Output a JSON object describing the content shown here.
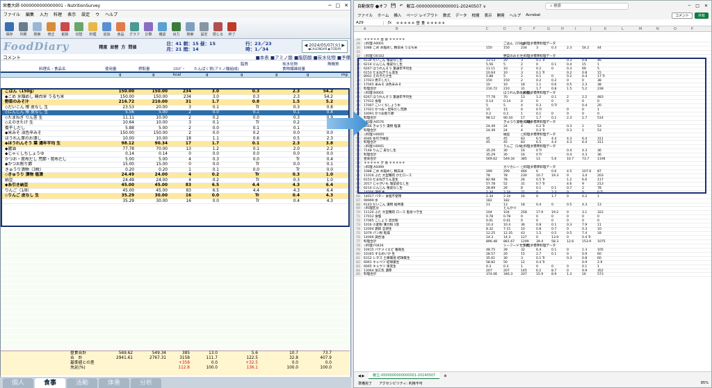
{
  "left": {
    "title": "栄養大師 0000000000000001 - NutritionSurvey",
    "menu": [
      "ファイル",
      "編集",
      "入力",
      "料理",
      "表示",
      "設定",
      "ウ",
      "ヘルプ"
    ],
    "tools": [
      "保存",
      "印刷",
      "検索",
      "修正",
      "削除",
      "切替",
      "料理",
      "追加",
      "食品",
      "グラフ",
      "計算",
      "確認",
      "出力",
      "検索",
      "設定",
      "閉じる",
      "終了"
    ],
    "logo": "FoodDiary",
    "buttons": [
      "精度",
      "並替",
      "方",
      "問値"
    ],
    "nut_a": [
      "日：41 朝：15 昼：15",
      "月：21 間：14"
    ],
    "nut_b": [
      "行：23／23",
      "時：1／34"
    ],
    "date": "◀ 2024/05/07(火) ▶",
    "date_sub": "◀CALENDAR ▶TODAY",
    "comment_label": "コメント",
    "flags": "■本表 ■アミノ酸 ■脂肪酸 ■炭水化物 ■予備",
    "cols": [
      "料理名・食品名",
      "使用量",
      "摂取量",
      "ｴﾈﾙｷﾞｰ",
      "たんぱく質(アミノ酸組成)",
      "脂質",
      "炭水化物",
      "食物繊維総量",
      "無機質"
    ],
    "units": [
      "g",
      "g",
      "kcal",
      "g",
      "g",
      "g",
      "g",
      "mg"
    ],
    "rows": [
      {
        "n": "ごはん（150g）",
        "a": "150.00",
        "b": "150.00",
        "e": "234",
        "p": "3.0",
        "f": "0.3",
        "c": "2.3",
        "x": "54.2",
        "t": "cat"
      },
      {
        "n": "◆こめ 水稲めし 精白米 うるち米",
        "a": "150.00",
        "b": "150.00",
        "e": "234",
        "p": "3.0",
        "f": "0.3",
        "c": "2.3",
        "x": "54.2",
        "t": ""
      },
      {
        "n": "野菜のみそ汁",
        "a": "216.72",
        "b": "210.00",
        "e": "31",
        "p": "1.7",
        "f": "0.8",
        "c": "1.5",
        "x": "5.2",
        "t": "cat"
      },
      {
        "n": "◇だいこん 根 皮なし 生",
        "a": "23.53",
        "b": "20.00",
        "e": "3",
        "p": "0.1",
        "f": "Tr",
        "c": "0.3",
        "x": "0.8",
        "t": ""
      },
      {
        "n": "◇にんじん 根 皮なし 生",
        "a": "5.56",
        "b": "5.00",
        "e": "2",
        "p": "0.0",
        "f": "0.1",
        "c": "0.1",
        "x": "0.4",
        "t": "sel"
      },
      {
        "n": "◇たまねぎ りん茎 生",
        "a": "11.11",
        "b": "10.00",
        "e": "2",
        "p": "0.2",
        "f": "0.0",
        "c": "0.3",
        "x": "0.9",
        "t": ""
      },
      {
        "n": "◇えのきたけ 生",
        "a": "10.64",
        "b": "10.00",
        "e": "3",
        "p": "0.1",
        "f": "Tr",
        "c": "0.2",
        "x": "0.8",
        "t": ""
      },
      {
        "n": "煮干しだし",
        "a": "5.88",
        "b": "5.00",
        "e": "2",
        "p": "0.0",
        "f": "0.1",
        "c": "0.1",
        "x": "0.4",
        "t": ""
      },
      {
        "n": "◆米みそ 淡色辛みそ",
        "a": "150.00",
        "b": "150.00",
        "e": "2",
        "p": "0.0",
        "f": "0.2",
        "c": "0.0",
        "x": "0.0",
        "t": ""
      },
      {
        "n": "ほうれん草のお浸し",
        "a": "10.00",
        "b": "10.00",
        "e": "18",
        "p": "1.1",
        "f": "0.6",
        "c": "0.5",
        "x": "2.3",
        "t": ""
      },
      {
        "n": "◆ほうれんそう 葉 通年平均 生",
        "a": "98.12",
        "b": "90.34",
        "e": "17",
        "p": "1.7",
        "f": "0.1",
        "c": "2.3",
        "x": "3.8",
        "t": "cat"
      },
      {
        "n": "◆醤油",
        "a": "77.78",
        "b": "70.00",
        "e": "13",
        "p": "1.2",
        "f": "0.1",
        "c": "2.0",
        "x": "2.2",
        "t": ""
      },
      {
        "n": "◆じゃくしちしょうゆ",
        "a": "0.14",
        "b": "0.14",
        "e": "0",
        "p": "0.0",
        "f": "0.0",
        "c": "0.0",
        "x": "0.0",
        "t": ""
      },
      {
        "n": "かつお・昆布だし 荒節・昆布だし",
        "a": "5.00",
        "b": "5.00",
        "e": "4",
        "p": "0.3",
        "f": "0.0",
        "c": "Tr",
        "x": "0.4",
        "t": ""
      },
      {
        "n": "◆かつお削り節",
        "a": "15.00",
        "b": "15.00",
        "e": "0",
        "p": "0.0",
        "f": "Tr",
        "c": "0.0",
        "x": "0.1",
        "t": ""
      },
      {
        "n": "きゅうり漬物（3枚）",
        "a": "0.20",
        "b": "0.20",
        "e": "1",
        "p": "0.1",
        "f": "0.0",
        "c": "Tr",
        "x": "0.0",
        "t": ""
      },
      {
        "n": "◇きゅうり 漬物 塩漬",
        "a": "24.49",
        "b": "24.00",
        "e": "4",
        "p": "0.2",
        "f": "Tr",
        "c": "0.3",
        "x": "1.0",
        "t": "cat"
      },
      {
        "n": "納豆",
        "a": "24.49",
        "b": "24.00",
        "e": "4",
        "p": "0.2",
        "f": "Tr",
        "c": "0.3",
        "x": "1.0",
        "t": ""
      },
      {
        "n": "◆糸引き納豆",
        "a": "45.00",
        "b": "45.00",
        "e": "83",
        "p": "6.5",
        "f": "4.4",
        "c": "4.3",
        "x": "6.4",
        "t": "cat"
      },
      {
        "n": "りんご（1/8）",
        "a": "45.00",
        "b": "45.00",
        "e": "83",
        "p": "6.5",
        "f": "4.4",
        "c": "4.3",
        "x": "6.4",
        "t": ""
      },
      {
        "n": "◇りんご 皮なし 生",
        "a": "35.29",
        "b": "30.00",
        "e": "16",
        "p": "0.0",
        "f": "Tr",
        "c": "0.4",
        "x": "4.3",
        "t": "cat"
      },
      {
        "n": "",
        "a": "35.29",
        "b": "30.00",
        "e": "16",
        "p": "0.0",
        "f": "Tr",
        "c": "0.4",
        "x": "4.3",
        "t": ""
      }
    ],
    "sum": [
      {
        "l": "昼食合計",
        "a": "569.62",
        "b": "549.34",
        "e": "385",
        "p": "13.0",
        "f": "5.6",
        "c": "10.7",
        "x": "73.7"
      },
      {
        "l": "合　計",
        "a": "2941.61",
        "b": "2767.31",
        "e": "3158",
        "p": "111.7",
        "f": "122.5",
        "c": "32.8",
        "x": "407.9"
      },
      {
        "l": "基準値との差",
        "a": "",
        "b": "",
        "e": "+358",
        "p": "0.0",
        "f": "+32.5",
        "c": "0.0",
        "x": "0.0"
      },
      {
        "l": "充足(%)",
        "a": "",
        "b": "",
        "e": "112.8",
        "p": "100.0",
        "f": "136.1",
        "c": "100.0",
        "x": "100.0"
      }
    ],
    "tabs": [
      "個人",
      "食事",
      "活動",
      "体重",
      "分析"
    ]
  },
  "right": {
    "title": "献立-0000000000000001-20240507 ∨",
    "autosave": "自動保存 ●オフ",
    "search": "検索",
    "menu": [
      "ファイル",
      "ホーム",
      "挿入",
      "ページ レイアウト",
      "数式",
      "データ",
      "校閲",
      "表示",
      "開発",
      "ヘルプ",
      "Acrobat"
    ],
    "btn_comment": "コメント",
    "btn_share": "共有",
    "cellref": "A29",
    "formula": "＊＊＊＊＊ 昼 食 ＊＊＊＊＊",
    "cols": [
      "A",
      "B",
      "C",
      "D",
      "E",
      "F",
      "G",
      "H",
      "I",
      "J",
      "K",
      "L",
      "M",
      "N",
      "O",
      "P"
    ],
    "rows": [
      [
        "28",
        "＊＊＊＊＊ 昼 食 ＊＊＊＊＊",
        "",
        "",
        "",
        "",
        "",
        "",
        "",
        ""
      ],
      [
        "29",
        "◇料理 A0001",
        "",
        "ごはん（150g）",
        "□料理ダ標準料理データ",
        "",
        "",
        "",
        "",
        ""
      ],
      [
        "30",
        "1088 こめ 水稲めし 精白米 うるち米",
        "150",
        "150",
        "234",
        "3",
        "0.3",
        "2.3",
        "54.2",
        "44"
      ],
      [
        "31",
        "",
        "",
        "",
        "",
        "",
        "",
        "",
        "",
        ""
      ],
      [
        "32",
        "◇料理 O0102",
        "",
        "野菜のみそ汁",
        "□料理ダ標準料理データ",
        "",
        "",
        "",
        "",
        ""
      ],
      [
        "33",
        "6134 だいこん 根皮なし生",
        "23.53",
        "20",
        "3",
        "0.1 Tr",
        "",
        "0.3",
        "0.8",
        "46"
      ],
      [
        "34",
        "6214 にんじん 根皮なし生",
        "5.56",
        "5",
        "2",
        "0",
        "0.1",
        "0.4",
        "15",
        "1"
      ],
      [
        "35",
        "6267 ほうれんそう 葉通年平均生",
        "11.11",
        "10",
        "2",
        "0.2",
        "0",
        "0.3",
        "69",
        "5"
      ],
      [
        "36",
        "6153 たまねぎりん茎生",
        "10.64",
        "10",
        "3",
        "0.1 Tr",
        "",
        "0.2",
        "0.8",
        "15"
      ],
      [
        "37",
        "8001 えのきたけ生",
        "5.88",
        "5",
        "2",
        "0.1",
        "0",
        "0.2",
        "0.4",
        "17 Tr"
      ],
      [
        "38",
        "17023 煮干しだし",
        "150",
        "150",
        "2",
        "0.2",
        "0.2",
        "0",
        "0",
        "38"
      ],
      [
        "39",
        "17045 米みそ 淡色辛みそ",
        "10",
        "10",
        "18",
        "1.1",
        "0.6",
        "0.5",
        "2.3",
        "38"
      ],
      [
        "40",
        "料理合計",
        "216.72",
        "210",
        "31",
        "1.7",
        "0.8",
        "1.5",
        "5.2",
        "238"
      ],
      [
        "41",
        "◇料理 B0001",
        "",
        "ほうれん草のお浸し",
        "□料理ダ標準料理データ",
        "",
        "",
        "",
        "",
        ""
      ],
      [
        "42",
        "6267 ほうれんそう 葉通年平均生",
        "77.78",
        "70",
        "13",
        "1.2",
        "0.1",
        "2",
        "2.2",
        "483"
      ],
      [
        "43",
        "17012 食塩",
        "0.14",
        "0.14",
        "0",
        "0",
        "0",
        "0",
        "0",
        "0"
      ],
      [
        "44",
        "17007 こいくちしょうゆ",
        "5",
        "5",
        "4",
        "0.3",
        "0 Tr",
        "",
        "0.4",
        "20"
      ],
      [
        "45",
        "17021 かつお・昆布だし荒節",
        "15",
        "15",
        "0",
        "0 Tr",
        "",
        "0",
        "0",
        "1"
      ],
      [
        "46",
        "10091 かつお削り節",
        "0.2",
        "0.2",
        "1",
        "0.1",
        "0",
        "0",
        "0",
        "0"
      ],
      [
        "47",
        "料理合計",
        "98.12",
        "90.34",
        "17",
        "1.7",
        "0.1",
        "2.3",
        "2.7",
        "514"
      ],
      [
        "48",
        "◇料理 A0576",
        "",
        "きゅうり漬物（3枚）",
        "□料理ダ標準料理データ",
        "",
        "",
        "",
        "",
        ""
      ],
      [
        "49",
        "6066 きゅうり 漬物 塩漬",
        "24.49",
        "24",
        "4",
        "0.2 Tr",
        "",
        "0.3",
        "1",
        "53"
      ],
      [
        "50",
        "料理合計",
        "24.49",
        "24",
        "4",
        "0.2 Tr",
        "",
        "0.3",
        "1",
        "53"
      ],
      [
        "51",
        "◇料理 H0005",
        "",
        "納豆",
        "□料理ダ標準料理データ",
        "",
        "",
        "",
        "",
        ""
      ],
      [
        "52",
        "4046 糸引き納豆",
        "45",
        "45",
        "83",
        "6.5",
        "4.4",
        "4.3",
        "6.4",
        "311"
      ],
      [
        "53",
        "料理合計",
        "45",
        "45",
        "83",
        "6.5",
        "4.4",
        "4.3",
        "6.4",
        "311"
      ],
      [
        "54",
        "◇料理 H0001",
        "",
        "りんご（1/8）",
        "□料理ダ標準料理データ",
        "",
        "",
        "",
        "",
        ""
      ],
      [
        "55",
        "7148 りんご 皮なし生",
        "35.29",
        "30",
        "16",
        "0 Tr",
        "",
        "0.4",
        "4.3",
        "36"
      ],
      [
        "56",
        "料理合計",
        "35.29",
        "30",
        "16",
        "0 Tr",
        "",
        "0.4",
        "4.3",
        "36"
      ],
      [
        "57",
        "昼食合計",
        "569.62",
        "549.34",
        "385",
        "13",
        "5.6",
        "10.7",
        "73.7",
        "1194"
      ],
      [
        "58",
        "＊＊＊＊＊ 夕 食 ＊＊＊＊＊",
        "",
        "",
        "",
        "",
        "",
        "",
        "",
        ""
      ],
      [
        "59",
        "◇料理 A0499",
        "",
        "カツカレー",
        "□料理ダ標準料理データ",
        "",
        "",
        "",
        "",
        ""
      ],
      [
        "60",
        "1088 こめ 水稲めし 精白米",
        "299",
        "299",
        "466",
        "6",
        "0.6",
        "4.5",
        "107.9",
        "87"
      ],
      [
        "61",
        "11016 ぶた 大型種肉 かたロース",
        "78",
        "78",
        "230",
        "10.7",
        "19.3",
        "0",
        "3.4",
        "203"
      ],
      [
        "62",
        "6153 たまねぎりん茎生",
        "82.98",
        "78",
        "26",
        "0.5 Tr",
        "",
        "1.2",
        "6.6",
        "117"
      ],
      [
        "63",
        "2017 じゃがいも 塊茎皮なし生",
        "57.78",
        "52",
        "31",
        "0.7 Tr",
        "",
        "4.6",
        "9",
        "213"
      ],
      [
        "64",
        "6214 にんじん 根皮なし生",
        "28.89",
        "26",
        "8",
        "0.1",
        "0.1",
        "0.7",
        "2",
        "78"
      ],
      [
        "65",
        "14006 調合油",
        "2.34",
        "2.34",
        "21",
        "0",
        "2.3",
        "0",
        "0",
        "0 Tr"
      ],
      [
        "66",
        "14017 バター 食塩不使用",
        "2.34",
        "2.34",
        "16",
        "0",
        "1.7",
        "0",
        "0.2",
        "1"
      ],
      [
        "67",
        "99999 水",
        "182",
        "182",
        "",
        "",
        "",
        "",
        "",
        ""
      ],
      [
        "68",
        "6143 だいこん 漬物 福神漬",
        "13",
        "13",
        "18",
        "0.4",
        "0",
        "0.5",
        "4.3",
        "13"
      ],
      [
        "69",
        "◇料理区分",
        "",
        "とんかつ",
        "",
        "",
        "",
        "",
        "",
        ""
      ],
      [
        "70",
        "11120 ぶた 大型種肉 ロース 脂身つき生",
        "104",
        "104",
        "258",
        "17.9",
        "19.2",
        "0",
        "3.1",
        "322"
      ],
      [
        "71",
        "17012 食塩",
        "0.78",
        "0.78",
        "0",
        "0",
        "0",
        "0",
        "0",
        "0"
      ],
      [
        "72",
        "17065 こしょう 混合粉",
        "0.01",
        "0.01",
        "0",
        "0",
        "0",
        "0",
        "0",
        "0"
      ],
      [
        "73",
        "1016 小麦粉 薄力粉 1等",
        "10.4",
        "10.4",
        "36",
        "0.8",
        "0.1",
        "0.3",
        "7.9",
        "11"
      ],
      [
        "74",
        "12004 鶏卵 全卵生",
        "8.32",
        "7.15",
        "10",
        "0.8",
        "0.7",
        "0",
        "0.3",
        "10"
      ],
      [
        "75",
        "1079 パン粉 乾燥",
        "12.25",
        "12.35",
        "43",
        "1.5",
        "0.5",
        "0.5",
        "7.4",
        "18"
      ],
      [
        "76",
        "14006 調合油",
        "14.3",
        "14.3",
        "127",
        "0",
        "13.9",
        "0",
        "0.4 Tr",
        ""
      ],
      [
        "77",
        "料理合計",
        "896.48",
        "881.67",
        "1299",
        "39.4",
        "58.3",
        "12.6",
        "153.9",
        "1075"
      ],
      [
        "78",
        "◇料理 F0426",
        "",
        "シーフードサラダ",
        "□料理ダ標準料理データ",
        "",
        "",
        "",
        "",
        ""
      ],
      [
        "79",
        "10415 バナメイエビ 養殖生",
        "48.75",
        "39",
        "32",
        "6.4",
        "0.1",
        "0",
        "1.3",
        "105"
      ],
      [
        "80",
        "10345 するめいか 生",
        "28.57",
        "20",
        "15",
        "2.7",
        "0.1",
        "0",
        "0.9",
        "60"
      ],
      [
        "81",
        "6312 レタス 土耕栽培 結球葉生",
        "35.61",
        "30",
        "3",
        "0.1 Tr",
        "",
        "0.3",
        "0.8",
        "60"
      ],
      [
        "82",
        "6061 キャベツ 結球葉生",
        "58.82",
        "50",
        "12",
        "0.4 Tr",
        "",
        "",
        "0.9",
        "2.9"
      ],
      [
        "83",
        "6065 キュウリ 果実生",
        "0.3",
        "0.3",
        "1",
        "0",
        "0",
        "0",
        "0.1",
        "1"
      ],
      [
        "84",
        "13064 加工乳 濃厚",
        "207",
        "207",
        "145",
        "6.2",
        "8.7",
        "0",
        "9.9",
        "352"
      ],
      [
        "85",
        "料理合計",
        "374.06",
        "346.3",
        "207",
        "15.9",
        "8.9",
        "1.3",
        "16",
        "573"
      ]
    ],
    "sheet": "献立-0000000000000001-20240507",
    "status_left": "準備完了",
    "status_acc": "アクセシビリティ: 利用不可",
    "zoom": "85%"
  }
}
